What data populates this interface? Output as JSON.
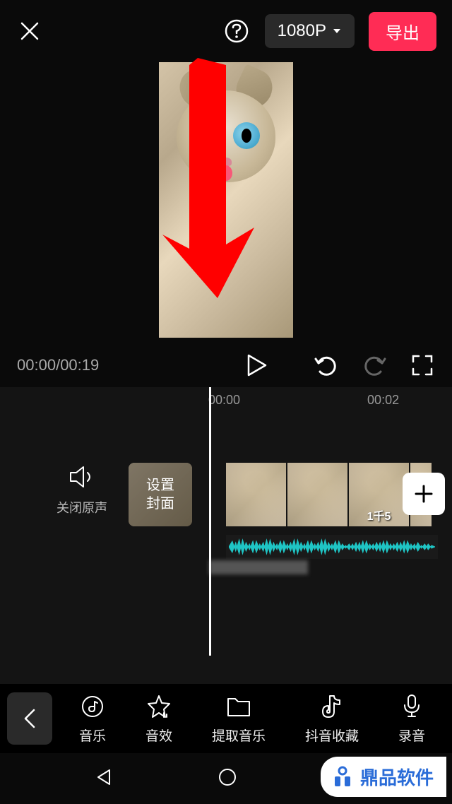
{
  "header": {
    "resolution": "1080P",
    "export_label": "导出"
  },
  "playback": {
    "current_time": "00:00",
    "total_time": "00:19"
  },
  "timeline": {
    "ruler": [
      "00:00",
      "00:02"
    ],
    "mute_label": "关闭原声",
    "cover_line1": "设置",
    "cover_line2": "封面",
    "clip_label": "1千5"
  },
  "toolbar": {
    "items": [
      {
        "label": "音乐",
        "icon": "music-note-icon"
      },
      {
        "label": "音效",
        "icon": "star-icon"
      },
      {
        "label": "提取音乐",
        "icon": "folder-icon"
      },
      {
        "label": "抖音收藏",
        "icon": "douyin-icon"
      },
      {
        "label": "录音",
        "icon": "microphone-icon"
      }
    ]
  },
  "watermark": {
    "text": "鼎品软件"
  }
}
